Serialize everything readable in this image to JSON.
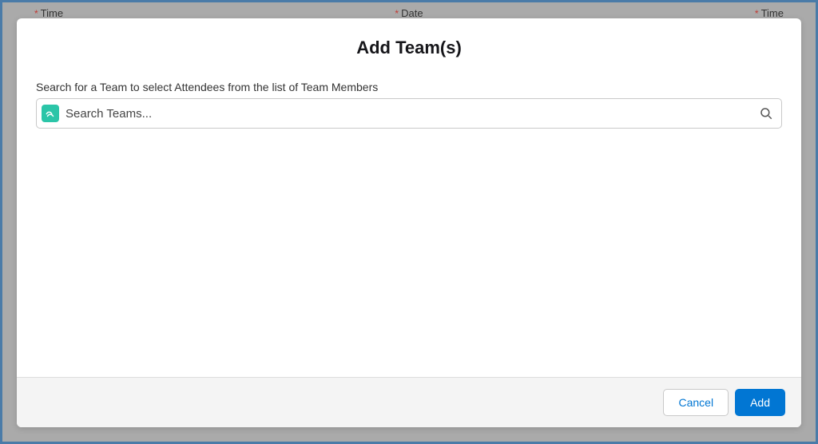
{
  "modal": {
    "title": "Add Team(s)",
    "search_label": "Search for a Team to select Attendees from the list of Team Members",
    "search_placeholder": "Search Teams..."
  },
  "footer": {
    "cancel_label": "Cancel",
    "add_label": "Add"
  },
  "backdrop": {
    "field1": "Time",
    "field2": "Date",
    "field3": "Time"
  }
}
